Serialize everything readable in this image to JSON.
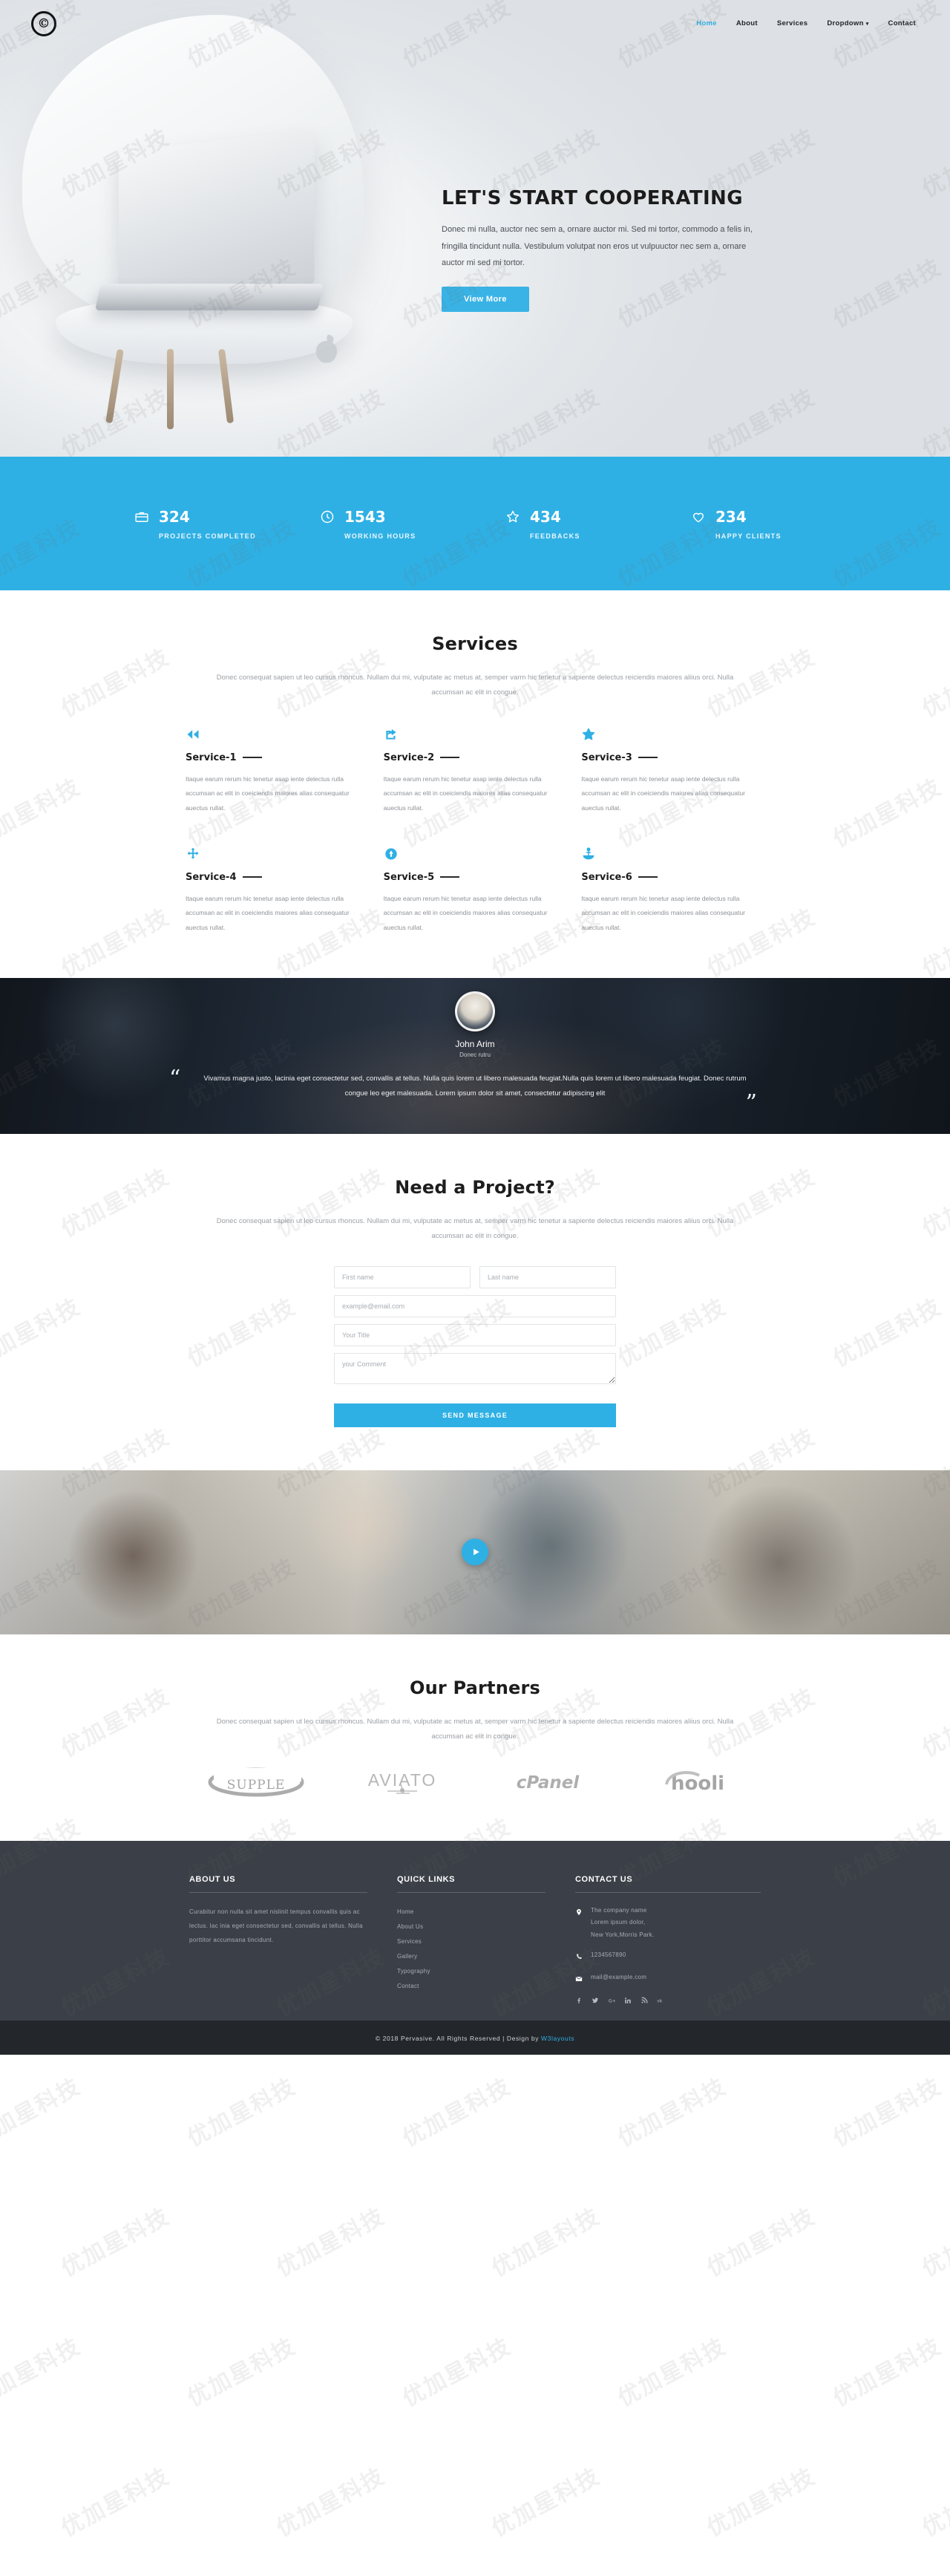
{
  "nav": {
    "logo": "©",
    "items": [
      {
        "label": "Home",
        "active": true
      },
      {
        "label": "About",
        "active": false
      },
      {
        "label": "Services",
        "active": false
      },
      {
        "label": "Dropdown",
        "active": false,
        "caret": "▾"
      },
      {
        "label": "Contact",
        "active": false
      }
    ]
  },
  "hero": {
    "title": "LET'S START COOPERATING",
    "text": "Donec mi nulla, auctor nec sem a, ornare auctor mi. Sed mi tortor, commodo a felis in, fringilla tincidunt nulla. Vestibulum volutpat non eros ut vulpuuctor nec sem a, ornare auctor mi sed mi tortor.",
    "button": "View More"
  },
  "stats": [
    {
      "icon": "briefcase-icon",
      "number": "324",
      "label": "PROJECTS COMPLETED"
    },
    {
      "icon": "clock-icon",
      "number": "1543",
      "label": "WORKING HOURS"
    },
    {
      "icon": "star-icon",
      "number": "434",
      "label": "FEEDBACKS"
    },
    {
      "icon": "heart-icon",
      "number": "234",
      "label": "HAPPY CLIENTS"
    }
  ],
  "services": {
    "title": "Services",
    "subtitle": "Donec consequat sapien ut leo cursus rhoncus. Nullam dui mi, vulputate ac metus at, semper varm hic tenetur a sapiente delectus reiciendis maiores aliius orci. Nulla accumsan ac elit in congue.",
    "items": [
      {
        "icon": "fast-backward-icon",
        "title": "Service-1",
        "text": "Itaque earum rerum hic tenetur asap iente delectus rulla accumsan ac elit in coeiciendis maiores alias consequatur auectus rullat."
      },
      {
        "icon": "share-square-icon",
        "title": "Service-2",
        "text": "Itaque earum rerum hic tenetur asap iente delectus rulla accumsan ac elit in coeiciendis maiores alias consequatur auectus rullat."
      },
      {
        "icon": "star-outline-icon",
        "title": "Service-3",
        "text": "Itaque earum rerum hic tenetur asap iente delectus rulla accumsan ac elit in coeiciendis maiores alias consequatur auectus rullat."
      },
      {
        "icon": "arrows-move-icon",
        "title": "Service-4",
        "text": "Itaque earum rerum hic tenetur asap iente delectus rulla accumsan ac elit in coeiciendis maiores alias consequatur auectus rullat."
      },
      {
        "icon": "arrow-circle-down-icon",
        "title": "Service-5",
        "text": "Itaque earum rerum hic tenetur asap iente delectus rulla accumsan ac elit in coeiciendis maiores alias consequatur auectus rullat."
      },
      {
        "icon": "anchor-icon",
        "title": "Service-6",
        "text": "Itaque earum rerum hic tenetur asap iente delectus rulla accumsan ac elit in coeiciendis maiores alias consequatur auectus rullat."
      }
    ]
  },
  "testimonial": {
    "name": "John Arim",
    "role": "Donec rutru",
    "quote": "Vivamus magna justo, lacinia eget consectetur sed, convallis at tellus. Nulla quis lorem ut libero malesuada feugiat.Nulla quis lorem ut libero malesuada feugiat. Donec rutrum congue leo eget malesuada. Lorem ipsum dolor sit amet, consectetur adipiscing elit",
    "quote_open": "“",
    "quote_close": "”"
  },
  "contact": {
    "title": "Need a Project?",
    "subtitle": "Donec consequat sapien ut leo cursus rhoncus. Nullam dui mi, vulputate ac metus at, semper varm hic tenetur a sapiente delectus reiciendis maiores aliius orci. Nulla accumsan ac elit in congue.",
    "first_name_placeholder": "First name",
    "last_name_placeholder": "Last name",
    "email_placeholder": "example@email.com",
    "title_placeholder": "Your Title",
    "comment_placeholder": "your Comment",
    "submit_label": "SEND MESSAGE"
  },
  "video": {
    "play_label": "play-video"
  },
  "partners": {
    "title": "Our Partners",
    "subtitle": "Donec consequat sapien ut leo cursus rhoncus. Nullam dui mi, vulputate ac metus at, semper varm hic tenetur a sapiente delectus reiciendis maiores aliius orci. Nulla accumsan ac elit in congue.",
    "logos": [
      "SUPPLE",
      "AVIATO",
      "cPanel",
      "hooli"
    ]
  },
  "footer": {
    "about": {
      "heading": "ABOUT US",
      "text": "Curabitur non nulla sit amet nislinit tempus convallis quis ac lectus. lac inia eget consectetur sed, convallis at tellus. Nulla porttitor accumsana tincidunt."
    },
    "quick_links": {
      "heading": "QUICK LINKS",
      "items": [
        "Home",
        "About Us",
        "Services",
        "Gallery",
        "Typography",
        "Contact"
      ]
    },
    "contact": {
      "heading": "CONTACT US",
      "address_line1": "The company name",
      "address_line2": "Lorem ipsum dolor,",
      "address_line3": "New York,Morris Park.",
      "phone": "1234567890",
      "email": "mail@example.com",
      "socials": [
        "facebook-icon",
        "twitter-icon",
        "google-plus-icon",
        "linkedin-icon",
        "rss-icon",
        "vk-icon"
      ]
    }
  },
  "copyright": {
    "text": "© 2018 Pervasive. All Rights Reserved | Design by ",
    "link": "W3layouts"
  },
  "colors": {
    "accent": "#2fb0e4",
    "footer_bg": "#3b4048",
    "copyright_bg": "#23262b"
  },
  "watermark": {
    "text": "优加星科技"
  }
}
